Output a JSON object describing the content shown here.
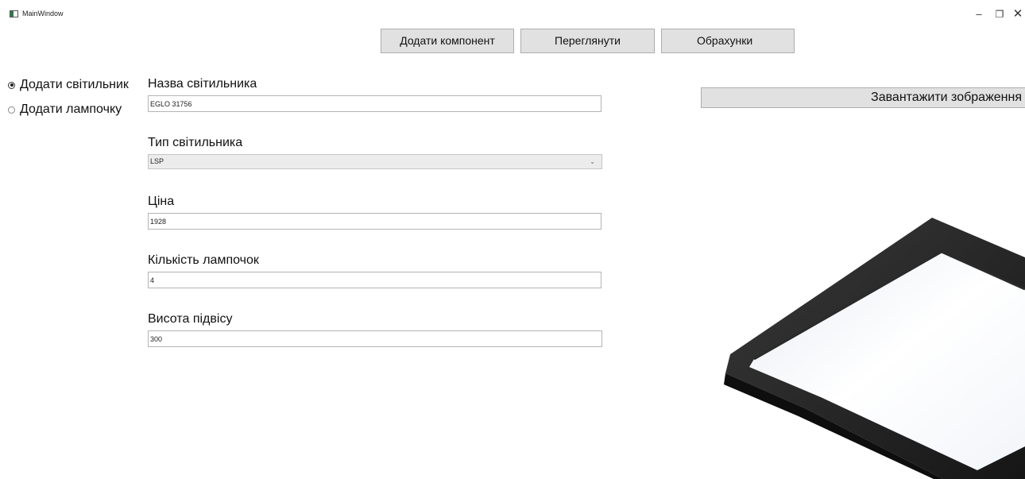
{
  "window": {
    "title": "MainWindow",
    "minimize_glyph": "–",
    "maximize_glyph": "❐",
    "close_glyph": "✕"
  },
  "nav": {
    "add_component": "Додати компонент",
    "view": "Переглянути",
    "calculations": "Обрахунки"
  },
  "mode": {
    "add_fixture": "Додати світильник",
    "add_bulb": "Додати лампочку",
    "selected": "add_fixture"
  },
  "form": {
    "name_label": "Назва світильника",
    "name_value": "EGLO 31756",
    "type_label": "Тип світильника",
    "type_value": "LSP",
    "price_label": "Ціна",
    "price_value": "1928",
    "bulbs_label": "Кількість лампочок",
    "bulbs_value": "4",
    "height_label": "Висота підвісу",
    "height_value": "300"
  },
  "image_panel": {
    "upload_label": "Завантажити зображення",
    "image_icon": "square-ceiling-lamp"
  }
}
